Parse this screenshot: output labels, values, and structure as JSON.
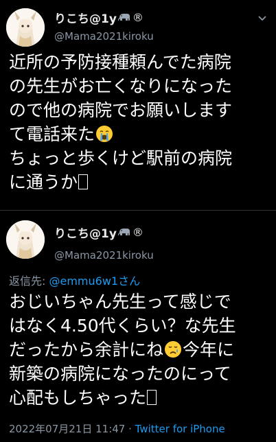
{
  "tweets": [
    {
      "display_name": "りこち@1y",
      "badge_icon": "elephant-icon",
      "registered_mark": "®",
      "handle": "@Mama2021kiroku",
      "body_lines": [
        "近所の予防接種頼んでた病院",
        "の先生がお亡くなりになった",
        "ので他の病院でお願いします",
        "て電話来た",
        "ちょっと歩くけど駅前の病院",
        "に通うか"
      ],
      "emoji": [
        "crying-face-emoji"
      ]
    },
    {
      "display_name": "りこち@1y",
      "badge_icon": "elephant-icon",
      "registered_mark": "®",
      "handle": "@Mama2021kiroku",
      "reply_label": "返信先: ",
      "reply_to": "@emmu6w1さん",
      "body_lines": [
        "おじいちゃん先生って感じで",
        "はなく4.50代くらい？な先生",
        "だったから余計にね",
        "今年に",
        "新築の病院になったのにって",
        "心配もしちゃった"
      ],
      "timestamp": "2022年07月21日 11:47 · ",
      "source": "Twitter for iPhone"
    }
  ],
  "colors": {
    "background": "#000000",
    "text": "#ffffff",
    "secondary_text": "#8b98a5",
    "link": "#1d9bf0",
    "divider": "#2f3336"
  }
}
